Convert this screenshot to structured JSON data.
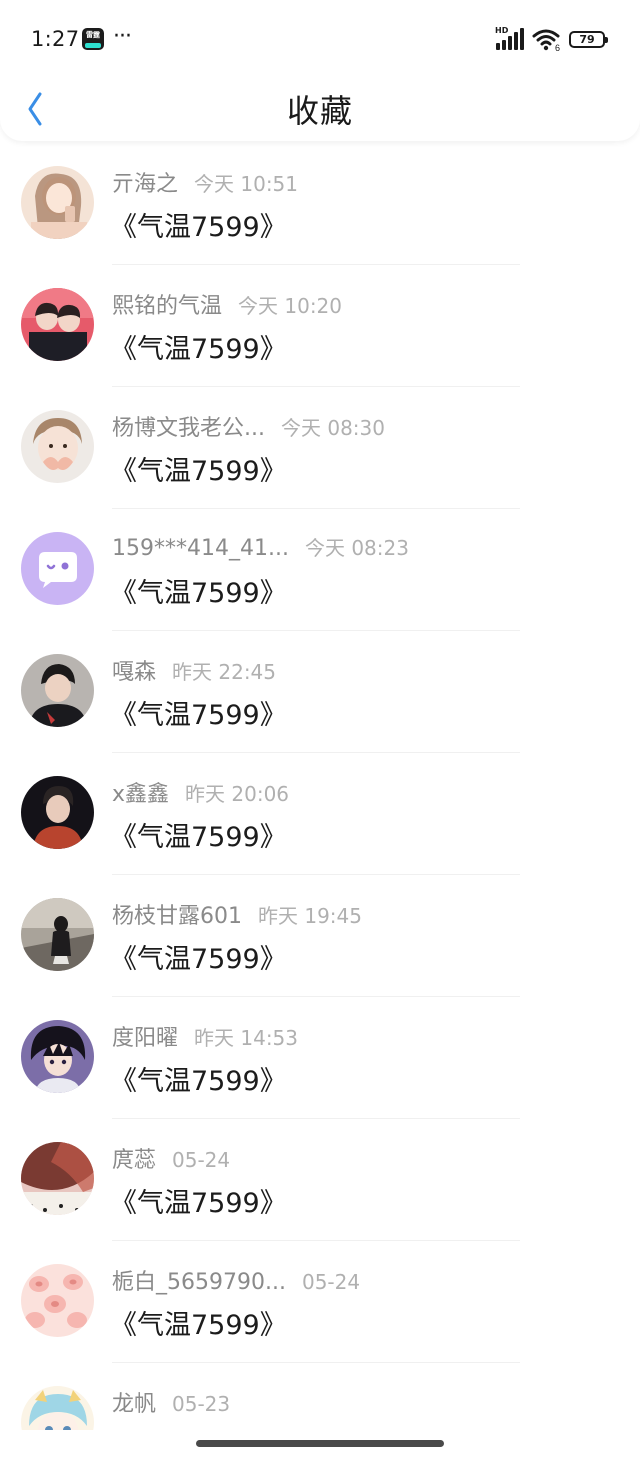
{
  "status_bar": {
    "time": "1:27",
    "app_badge_text": "雷霆",
    "more": "···",
    "signal_label": "HD",
    "wifi_label": "6",
    "battery_level": "79"
  },
  "nav": {
    "title": "收藏",
    "back_icon": "chevron-left-icon"
  },
  "colors": {
    "accent": "#3a8ee6",
    "name_text": "#8a8a8a",
    "time_text": "#b0b0b0",
    "title_text": "#1c1c1c"
  },
  "items": [
    {
      "name": "亓海之",
      "time": "今天 10:51",
      "title": "《气温7599》"
    },
    {
      "name": "熙铭的气温",
      "time": "今天 10:20",
      "title": "《气温7599》"
    },
    {
      "name": "杨博文我老公...",
      "time": "今天 08:30",
      "title": "《气温7599》"
    },
    {
      "name": "159***414_41...",
      "time": "今天 08:23",
      "title": "《气温7599》"
    },
    {
      "name": "嘎森",
      "time": "昨天 22:45",
      "title": "《气温7599》"
    },
    {
      "name": "x鑫鑫",
      "time": "昨天 20:06",
      "title": "《气温7599》"
    },
    {
      "name": "杨枝甘露601",
      "time": "昨天 19:45",
      "title": "《气温7599》"
    },
    {
      "name": "度阳曜",
      "time": "昨天 14:53",
      "title": "《气温7599》"
    },
    {
      "name": "庹蕊",
      "time": "05-24",
      "title": "《气温7599》"
    },
    {
      "name": "栀白_5659790...",
      "time": "05-24",
      "title": "《气温7599》"
    },
    {
      "name": "龙帆",
      "time": "05-23",
      "title": ""
    }
  ]
}
